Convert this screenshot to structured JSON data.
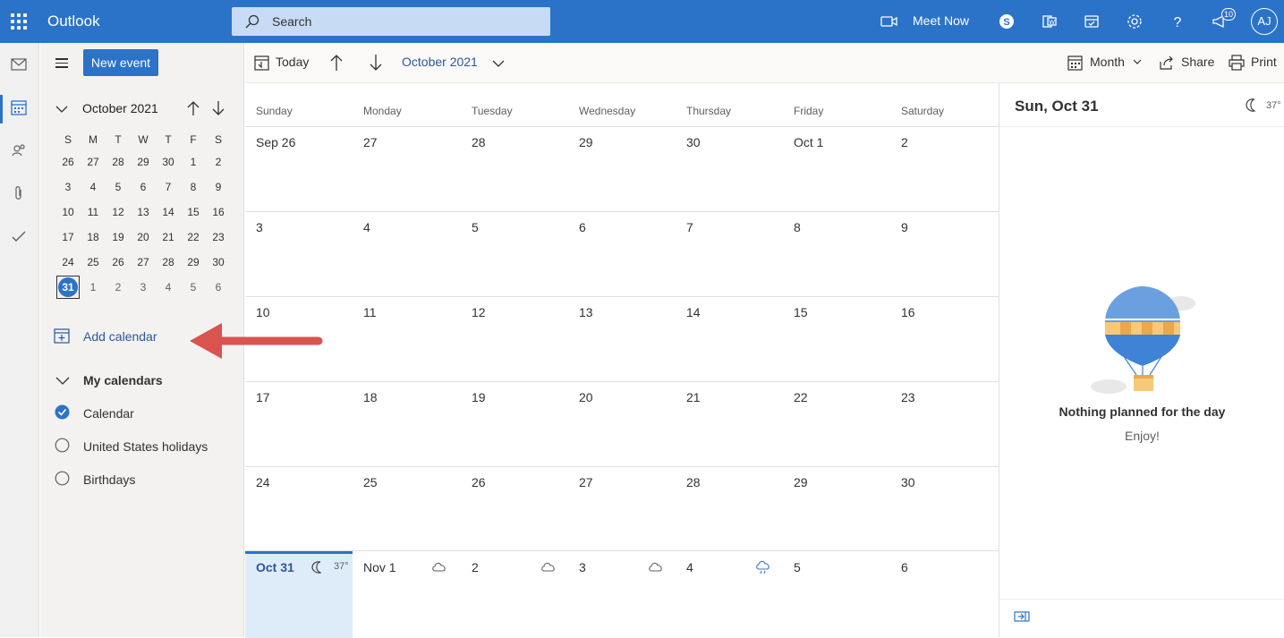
{
  "app": {
    "title": "Outlook"
  },
  "search": {
    "placeholder": "Search"
  },
  "header": {
    "meet_now": "Meet Now",
    "notifications_count": "10",
    "avatar_initials": "AJ"
  },
  "leftpane": {
    "new_event": "New event",
    "mini_month": {
      "title": "October 2021",
      "weekdays": [
        "S",
        "M",
        "T",
        "W",
        "T",
        "F",
        "S"
      ],
      "weeks": [
        [
          "26",
          "27",
          "28",
          "29",
          "30",
          "1",
          "2"
        ],
        [
          "3",
          "4",
          "5",
          "6",
          "7",
          "8",
          "9"
        ],
        [
          "10",
          "11",
          "12",
          "13",
          "14",
          "15",
          "16"
        ],
        [
          "17",
          "18",
          "19",
          "20",
          "21",
          "22",
          "23"
        ],
        [
          "24",
          "25",
          "26",
          "27",
          "28",
          "29",
          "30"
        ],
        [
          "31",
          "1",
          "2",
          "3",
          "4",
          "5",
          "6"
        ]
      ],
      "selected": "31"
    },
    "add_calendar": "Add calendar",
    "my_calendars": "My calendars",
    "calendars": [
      {
        "label": "Calendar",
        "checked": true
      },
      {
        "label": "United States holidays",
        "checked": false
      },
      {
        "label": "Birthdays",
        "checked": false
      }
    ]
  },
  "commandbar": {
    "today": "Today",
    "month_label": "October 2021",
    "view": "Month",
    "share": "Share",
    "print": "Print"
  },
  "calendar": {
    "day_headers": [
      "Sunday",
      "Monday",
      "Tuesday",
      "Wednesday",
      "Thursday",
      "Friday",
      "Saturday"
    ],
    "weeks": [
      [
        "Sep 26",
        "27",
        "28",
        "29",
        "30",
        "Oct 1",
        "2"
      ],
      [
        "3",
        "4",
        "5",
        "6",
        "7",
        "8",
        "9"
      ],
      [
        "10",
        "11",
        "12",
        "13",
        "14",
        "15",
        "16"
      ],
      [
        "17",
        "18",
        "19",
        "20",
        "21",
        "22",
        "23"
      ],
      [
        "24",
        "25",
        "26",
        "27",
        "28",
        "29",
        "30"
      ],
      [
        "Oct 31",
        "Nov 1",
        "2",
        "3",
        "4",
        "5",
        "6"
      ]
    ],
    "today_temp": "37°"
  },
  "rightpane": {
    "date": "Sun, Oct 31",
    "temp": "37°",
    "empty_title": "Nothing planned for the day",
    "empty_sub": "Enjoy!"
  },
  "colors": {
    "accent": "#2b73c9",
    "today_bg": "#deecf9",
    "arrow": "#d9534f"
  }
}
